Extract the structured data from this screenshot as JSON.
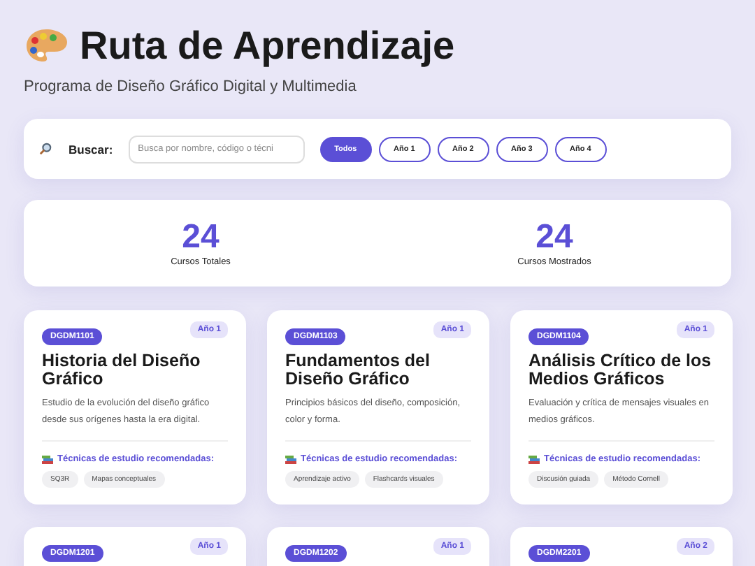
{
  "header": {
    "title": "Ruta de Aprendizaje",
    "subtitle": "Programa de Diseño Gráfico Digital y Multimedia"
  },
  "search": {
    "label": "Buscar:",
    "placeholder": "Busca por nombre, código o técni"
  },
  "filters": [
    {
      "label": "Todos",
      "selected": true
    },
    {
      "label": "Año 1",
      "selected": false
    },
    {
      "label": "Año 2",
      "selected": false
    },
    {
      "label": "Año 3",
      "selected": false
    },
    {
      "label": "Año 4",
      "selected": false
    }
  ],
  "stats": [
    {
      "value": "24",
      "label": "Cursos Totales"
    },
    {
      "value": "24",
      "label": "Cursos Mostrados"
    }
  ],
  "courses": [
    {
      "code": "DGDM1101",
      "year": "Año 1",
      "title": "Historia del Diseño Gráfico",
      "description": "Estudio de la evolución del diseño gráfico desde sus orígenes hasta la era digital.",
      "techniques_heading": "Técnicas de estudio recomendadas:",
      "techniques": [
        "SQ3R",
        "Mapas conceptuales"
      ]
    },
    {
      "code": "DGDM1103",
      "year": "Año 1",
      "title": "Fundamentos del Diseño Gráfico",
      "description": "Principios básicos del diseño, composición, color y forma.",
      "techniques_heading": "Técnicas de estudio recomendadas:",
      "techniques": [
        "Aprendizaje activo",
        "Flashcards visuales"
      ]
    },
    {
      "code": "DGDM1104",
      "year": "Año 1",
      "title": "Análisis Crítico de los Medios Gráficos",
      "description": "Evaluación y crítica de mensajes visuales en medios gráficos.",
      "techniques_heading": "Técnicas de estudio recomendadas:",
      "techniques": [
        "Discusión guiada",
        "Método Cornell"
      ]
    },
    {
      "code": "DGDM1201",
      "year": "Año 1"
    },
    {
      "code": "DGDM1202",
      "year": "Año 1"
    },
    {
      "code": "DGDM2201",
      "year": "Año 2"
    }
  ]
}
